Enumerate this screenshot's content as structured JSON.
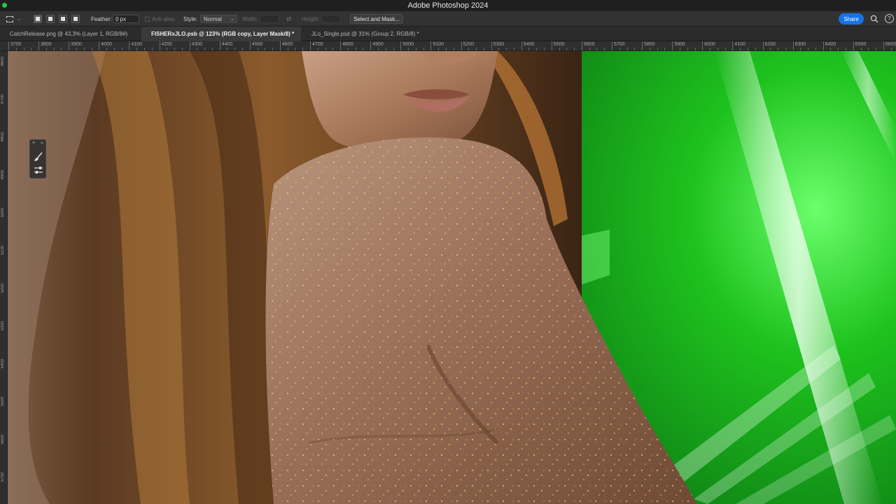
{
  "app": {
    "title": "Adobe Photoshop 2024"
  },
  "options_bar": {
    "feather_label": "Feather:",
    "feather_value": "0 px",
    "anti_alias_label": "Anti-alias",
    "style_label": "Style:",
    "style_value": "Normal",
    "width_label": "Width:",
    "height_label": "Height:",
    "select_and_mask_label": "Select and Mask...",
    "share_label": "Share"
  },
  "tabs": [
    {
      "label": "CatchRelease.png @ 43,3% (Layer 1, RGB/8#)",
      "active": false
    },
    {
      "label": "FISHERxJLO.psb @ 123% (RGB copy, Layer Mask/8) *",
      "active": true
    },
    {
      "label": "JLo_Single.psd @ 31% (Group 2, RGB/8) *",
      "active": false
    }
  ],
  "ruler_h": [
    "3700",
    "3800",
    "3900",
    "4000",
    "4100",
    "4200",
    "4300",
    "4400",
    "4500",
    "4600",
    "4700",
    "4800",
    "4900",
    "5000",
    "5100",
    "5200",
    "5300",
    "5400",
    "5500",
    "5600",
    "5700",
    "5800",
    "5900",
    "6000",
    "4100",
    "6200",
    "6300",
    "6400",
    "6500",
    "6600"
  ],
  "ruler_v": [
    "4600",
    "4700",
    "4800",
    "4900",
    "5000",
    "5100",
    "5200",
    "5300",
    "5400",
    "5500",
    "5600",
    "5700"
  ],
  "icons": {
    "marquee": "rect-marquee-icon",
    "brush": "brush-icon",
    "adjust": "sliders-icon",
    "search": "search-icon",
    "help": "help-icon"
  },
  "colors": {
    "accent": "#1473e6",
    "green_bg": "#1ec21e"
  }
}
